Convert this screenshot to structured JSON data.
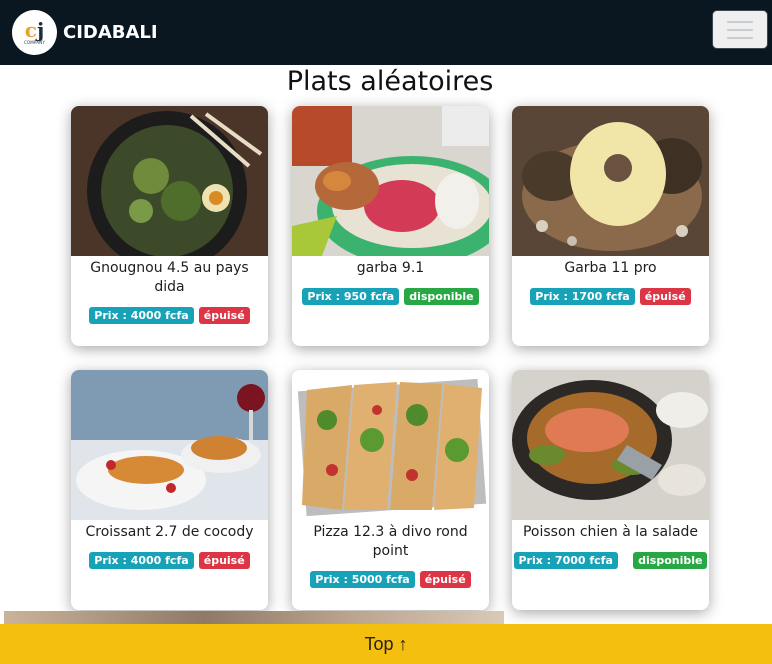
{
  "navbar": {
    "brand": "CIDABALI",
    "logo_text": "COMPANY"
  },
  "section": {
    "title": "Plats aléatoires"
  },
  "dishes": [
    {
      "name": "Gnougnou 4.5 au pays dida",
      "price": "Prix : 4000 fcfa",
      "status": "épuisé"
    },
    {
      "name": "garba 9.1",
      "price": "Prix : 950 fcfa",
      "status": "disponible"
    },
    {
      "name": "Garba 11 pro",
      "price": "Prix : 1700 fcfa",
      "status": "épuisé"
    },
    {
      "name": "Croissant 2.7 de cocody",
      "price": "Prix : 4000 fcfa",
      "status": "épuisé"
    },
    {
      "name": "Pizza 12.3 à divo rond point",
      "price": "Prix : 5000 fcfa",
      "status": "épuisé"
    },
    {
      "name": "Poisson chien à la salade",
      "price": "Prix : 7000 fcfa",
      "status": "disponible"
    }
  ],
  "footer": {
    "top_label": "Top ↑"
  },
  "colors": {
    "navbar": "#0b1720",
    "price_badge": "#17a2b8",
    "out_badge": "#dc3545",
    "available_badge": "#28a745",
    "top_button": "#f4bf0f"
  }
}
